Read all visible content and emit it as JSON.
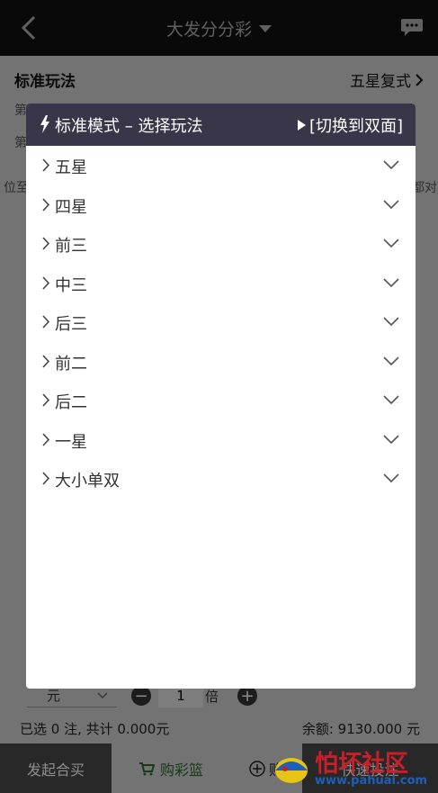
{
  "header": {
    "title": "大发分分彩"
  },
  "mode_row": {
    "left": "标准玩法",
    "right": "五星复式"
  },
  "background_text": {
    "line1_prefix": "第",
    "line2_prefix": "第",
    "left_clip": "位至",
    "right_clip": "都对"
  },
  "modal": {
    "title": "标准模式 – 选择玩法",
    "switch_label": "[切换到双面]",
    "items": [
      {
        "label": "五星"
      },
      {
        "label": "四星"
      },
      {
        "label": "前三"
      },
      {
        "label": "中三"
      },
      {
        "label": "后三"
      },
      {
        "label": "前二"
      },
      {
        "label": "后二"
      },
      {
        "label": "一星"
      },
      {
        "label": "大小单双"
      }
    ]
  },
  "multiplier": {
    "unit": "元",
    "value": "1",
    "suffix": "倍"
  },
  "summary": {
    "selected": "已选 0 注, 共计 0.000元",
    "balance": "余额: 9130.000 元"
  },
  "footer": {
    "group_buy": "发起合买",
    "cart": "购彩篮",
    "add_clip": "购",
    "quick_clip": "快速投注"
  },
  "watermark": {
    "text": "怕坏社区",
    "url": "www.pahuai.com"
  },
  "colors": {
    "topbar": "#111111",
    "modal_header": "#39364a",
    "footer_dark": "#4a4a4a",
    "cart_green": "#2f6b2f"
  }
}
